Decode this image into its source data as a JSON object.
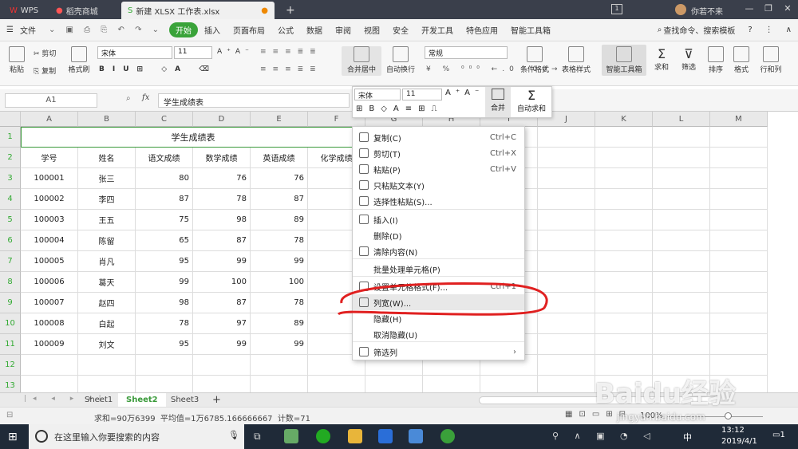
{
  "titlebar": {
    "app": "WPS",
    "tabs": [
      "稻壳商城",
      "新建 XLSX 工作表.xlsx"
    ],
    "badge": "1",
    "user": "你若不来"
  },
  "menubar": {
    "file": "文件",
    "items": [
      "开始",
      "插入",
      "页面布局",
      "公式",
      "数据",
      "审阅",
      "视图",
      "安全",
      "开发工具",
      "特色应用",
      "智能工具箱"
    ],
    "search": "查找命令、搜索模板"
  },
  "ribbon": {
    "paste": "粘贴",
    "cut": "剪切",
    "copy": "复制",
    "format_painter": "格式刷",
    "font": "宋体",
    "size": "11",
    "merge": "合并居中",
    "wrap": "自动换行",
    "numfmt": "常规",
    "cond": "条件格式",
    "table": "表格样式",
    "smart": "智能工具箱",
    "sum": "求和",
    "filter": "筛选",
    "sort": "排序",
    "fmt": "格式",
    "rowcol": "行和列"
  },
  "formula": {
    "cellref": "A1",
    "fx": "fx",
    "value": "学生成绩表"
  },
  "mini": {
    "font": "宋体",
    "size": "11",
    "merge": "合并",
    "autosum": "自动求和"
  },
  "columns": [
    "A",
    "B",
    "C",
    "D",
    "E",
    "F",
    "G",
    "H",
    "I",
    "J",
    "K",
    "L",
    "M"
  ],
  "rows": [
    "1",
    "2",
    "3",
    "4",
    "5",
    "6",
    "7",
    "8",
    "9",
    "10",
    "11",
    "12",
    "13"
  ],
  "sheet": {
    "title": "学生成绩表",
    "headers": [
      "学号",
      "姓名",
      "语文成绩",
      "数学成绩",
      "英语成绩",
      "化学成绩"
    ],
    "data": [
      [
        "100001",
        "张三",
        "80",
        "76",
        "76"
      ],
      [
        "100002",
        "李四",
        "87",
        "78",
        "87"
      ],
      [
        "100003",
        "王五",
        "75",
        "98",
        "89"
      ],
      [
        "100004",
        "陈留",
        "65",
        "87",
        "78"
      ],
      [
        "100005",
        "肖凡",
        "95",
        "99",
        "99"
      ],
      [
        "100006",
        "葛天",
        "99",
        "100",
        "100"
      ],
      [
        "100007",
        "赵四",
        "98",
        "87",
        "78"
      ],
      [
        "100008",
        "白起",
        "78",
        "97",
        "89"
      ],
      [
        "100009",
        "刘文",
        "95",
        "99",
        "99"
      ]
    ]
  },
  "context_menu": [
    {
      "label": "复制(C)",
      "shortcut": "Ctrl+C"
    },
    {
      "label": "剪切(T)",
      "shortcut": "Ctrl+X"
    },
    {
      "label": "粘贴(P)",
      "shortcut": "Ctrl+V"
    },
    {
      "label": "只粘贴文本(Y)",
      "shortcut": ""
    },
    {
      "label": "选择性粘贴(S)...",
      "shortcut": ""
    },
    {
      "label": "插入(I)",
      "shortcut": ""
    },
    {
      "label": "删除(D)",
      "shortcut": ""
    },
    {
      "label": "清除内容(N)",
      "shortcut": ""
    },
    {
      "label": "批量处理单元格(P)",
      "shortcut": ""
    },
    {
      "label": "设置单元格格式(F)...",
      "shortcut": "Ctrl+1"
    },
    {
      "label": "列宽(W)...",
      "shortcut": ""
    },
    {
      "label": "隐藏(H)",
      "shortcut": ""
    },
    {
      "label": "取消隐藏(U)",
      "shortcut": ""
    },
    {
      "label": "筛选列",
      "shortcut": ""
    }
  ],
  "sheets": [
    "Sheet1",
    "Sheet2",
    "Sheet3"
  ],
  "status": {
    "text": "求和=90万6399  平均值=1万6785.166666667  计数=71",
    "zoom": "100%"
  },
  "taskbar": {
    "search": "在这里输入你要搜索的内容",
    "ime": "中",
    "time": "13:12",
    "date": "2019/4/1",
    "notif": "1"
  },
  "watermark": {
    "brand": "Baidu经验",
    "url": "jingyan.baidu.com"
  },
  "colors": {
    "accent": "#3aa33a",
    "annotation": "#e02020"
  }
}
